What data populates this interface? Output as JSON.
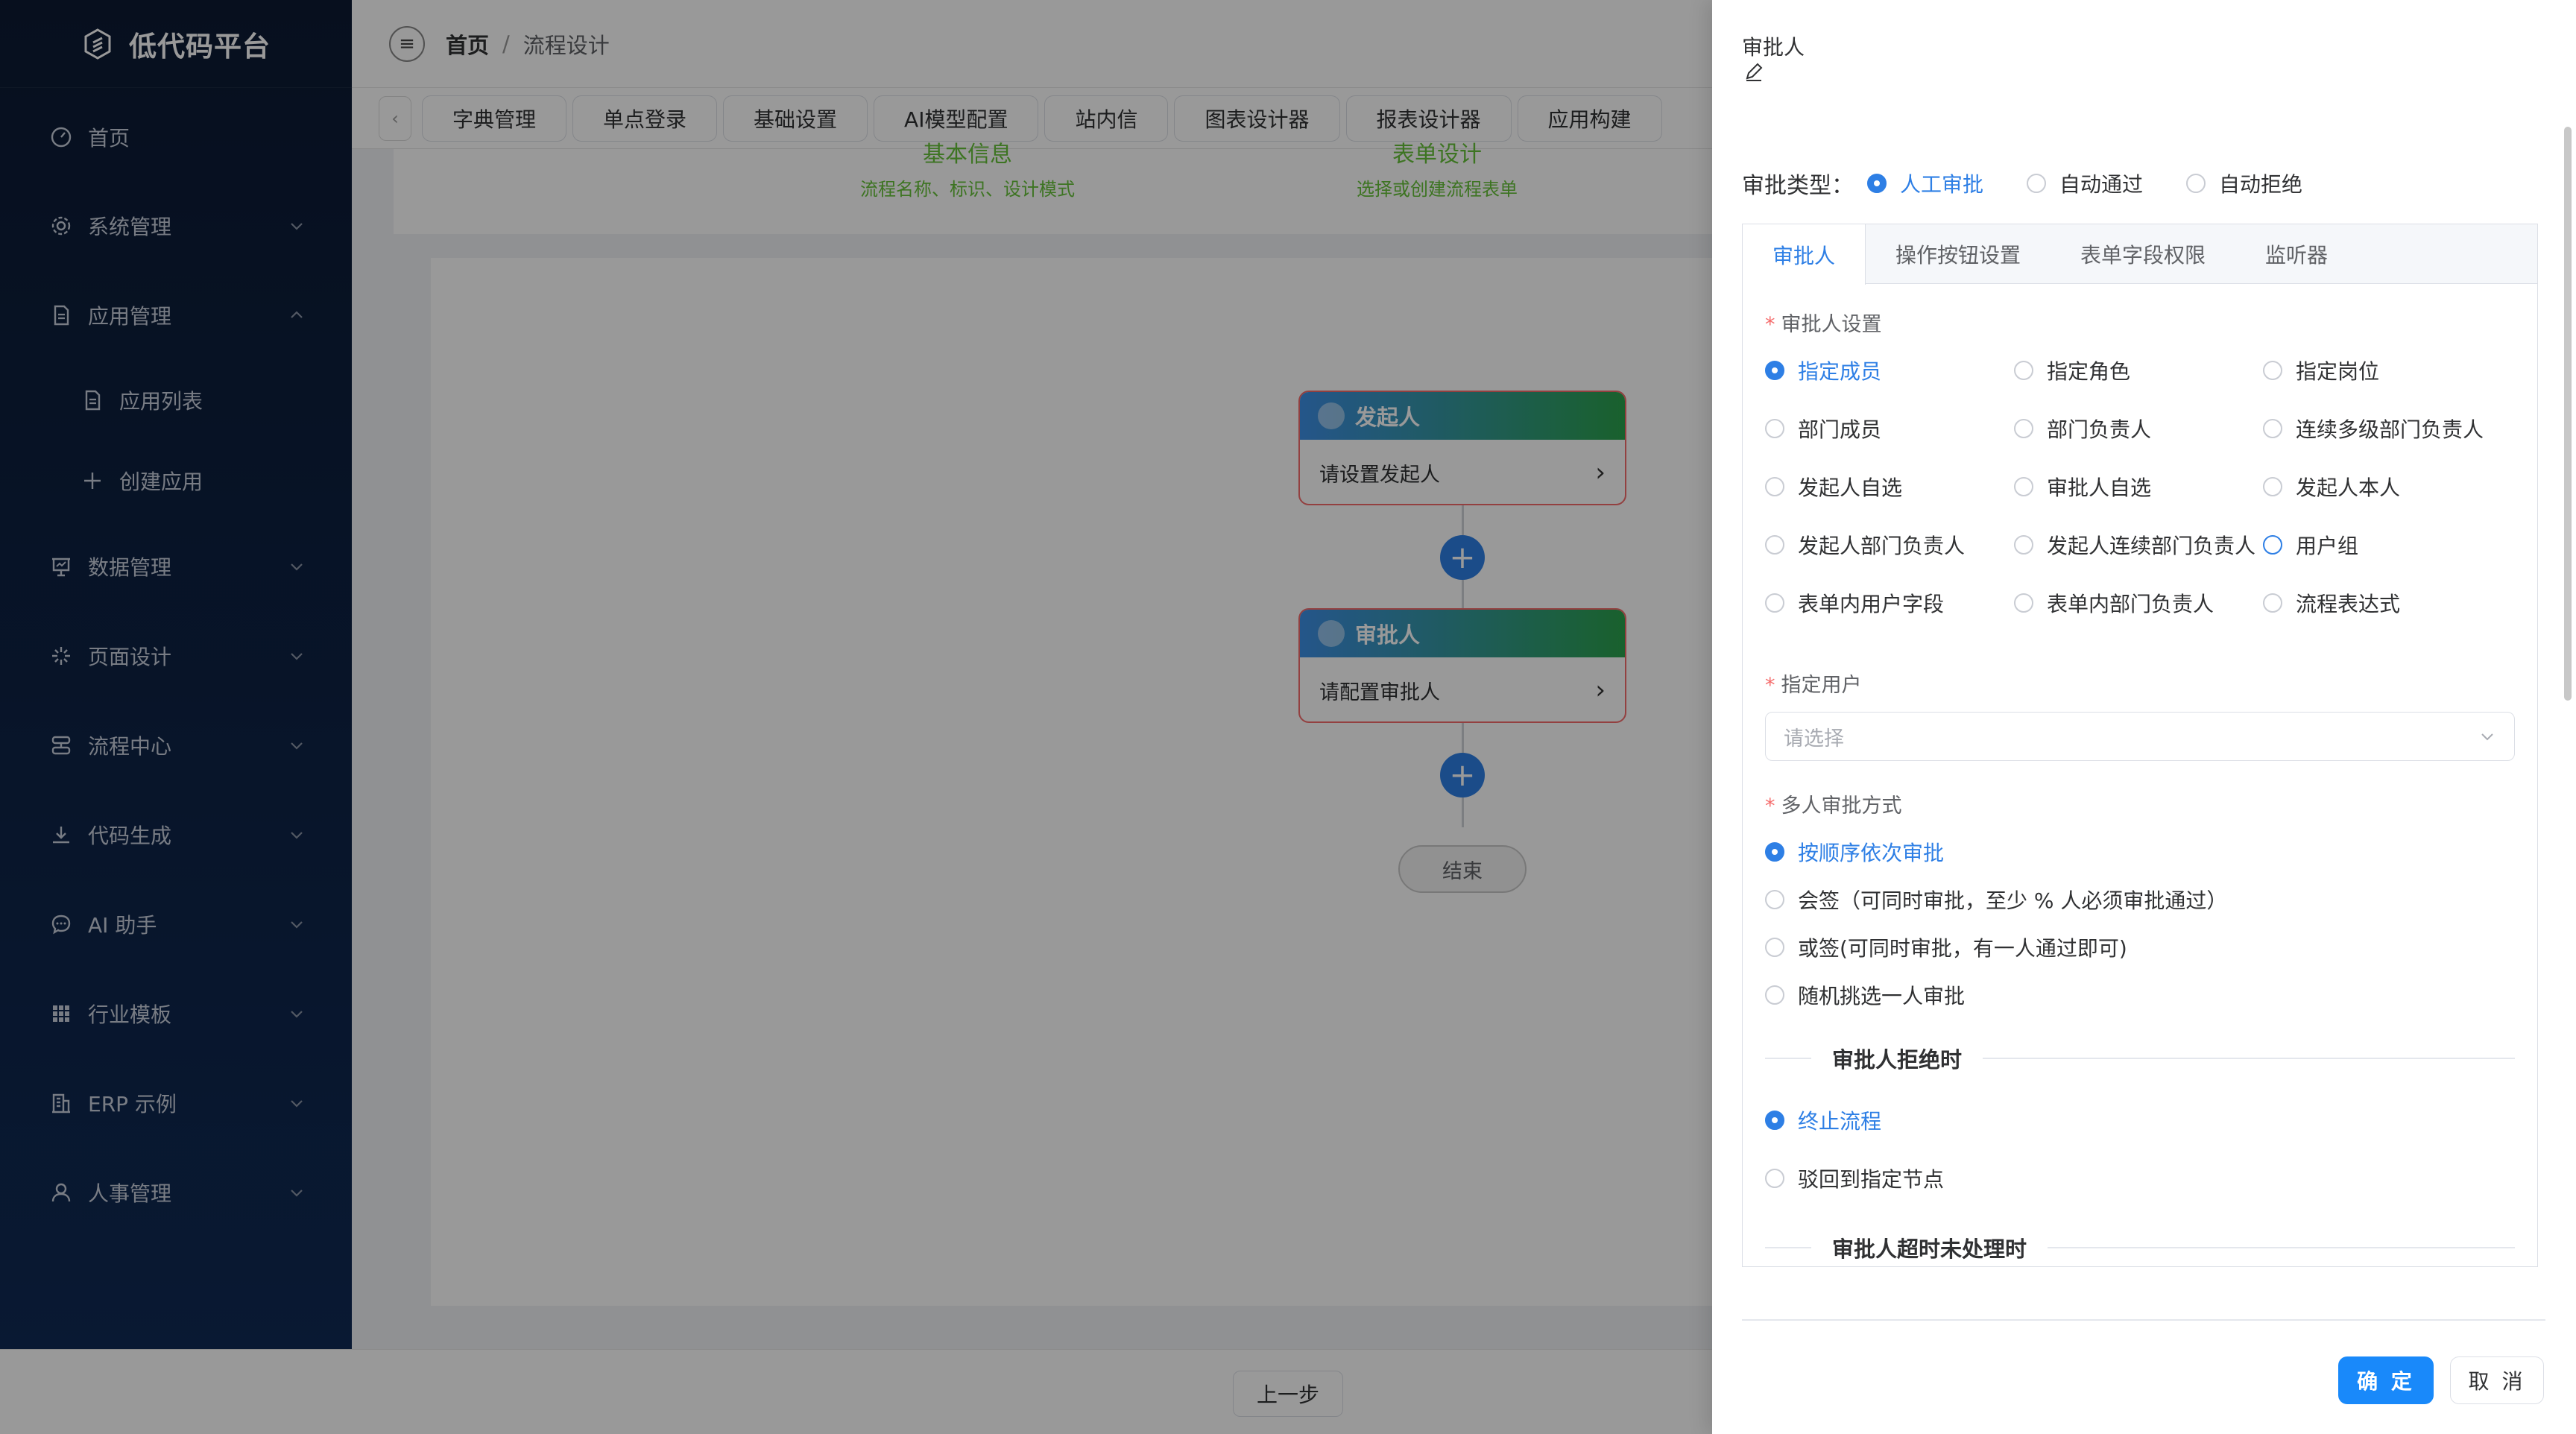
{
  "app": {
    "title": "低代码平台"
  },
  "sidebar": {
    "items": [
      {
        "label": "首页",
        "icon": "dashboard-icon"
      },
      {
        "label": "系统管理",
        "icon": "gear-icon"
      },
      {
        "label": "应用管理",
        "icon": "document-icon",
        "expanded": true
      },
      {
        "label": "应用列表",
        "icon": "document-icon",
        "sub": true
      },
      {
        "label": "创建应用",
        "icon": "plus-icon",
        "sub": true
      },
      {
        "label": "数据管理",
        "icon": "presentation-icon"
      },
      {
        "label": "页面设计",
        "icon": "sparkle-icon"
      },
      {
        "label": "流程中心",
        "icon": "flow-icon"
      },
      {
        "label": "代码生成",
        "icon": "download-icon"
      },
      {
        "label": "AI 助手",
        "icon": "chat-icon"
      },
      {
        "label": "行业模板",
        "icon": "grid-icon"
      },
      {
        "label": "ERP 示例",
        "icon": "building-icon"
      },
      {
        "label": "人事管理",
        "icon": "user-icon"
      }
    ]
  },
  "breadcrumb": {
    "home": "首页",
    "separator": "/",
    "current": "流程设计"
  },
  "tabs": [
    "字典管理",
    "单点登录",
    "基础设置",
    "AI模型配置",
    "站内信",
    "图表设计器",
    "报表设计器",
    "应用构建"
  ],
  "steps": [
    {
      "title": "基本信息",
      "desc": "流程名称、标识、设计模式"
    },
    {
      "title": "表单设计",
      "desc": "选择或创建流程表单"
    }
  ],
  "flow": {
    "start_node": {
      "title": "发起人",
      "body": "请设置发起人"
    },
    "approver_node": {
      "title": "审批人",
      "body": "请配置审批人"
    },
    "end_node": "结束"
  },
  "bottom": {
    "prev_label": "上一步"
  },
  "drawer": {
    "title": "审批人",
    "approval_type": {
      "label": "审批类型：",
      "options": [
        "人工审批",
        "自动通过",
        "自动拒绝"
      ],
      "selected": "人工审批"
    },
    "tabs": [
      "审批人",
      "操作按钮设置",
      "表单字段权限",
      "监听器"
    ],
    "active_tab": "审批人",
    "approver_setting": {
      "label": "审批人设置",
      "options": [
        "指定成员",
        "指定角色",
        "指定岗位",
        "部门成员",
        "部门负责人",
        "连续多级部门负责人",
        "发起人自选",
        "审批人自选",
        "发起人本人",
        "发起人部门负责人",
        "发起人连续部门负责人",
        "用户组",
        "表单内用户字段",
        "表单内部门负责人",
        "流程表达式"
      ],
      "selected": "指定成员"
    },
    "assign_user": {
      "label": "指定用户",
      "placeholder": "请选择"
    },
    "multi_approve": {
      "label": "多人审批方式",
      "options": [
        "按顺序依次审批",
        "会签（可同时审批，至少 % 人必须审批通过）",
        "或签(可同时审批，有一人通过即可)",
        "随机挑选一人审批"
      ],
      "selected": "按顺序依次审批"
    },
    "reject_section": {
      "title": "审批人拒绝时",
      "options": [
        "终止流程",
        "驳回到指定节点"
      ],
      "selected": "终止流程"
    },
    "timeout_section": {
      "title": "审批人超时未处理时"
    },
    "ok_label": "确 定",
    "cancel_label": "取 消"
  },
  "colors": {
    "primary": "#2e7fe5",
    "sidebar_bg": "#0c1a33",
    "danger": "#f56c6c",
    "success": "#67c23a"
  }
}
